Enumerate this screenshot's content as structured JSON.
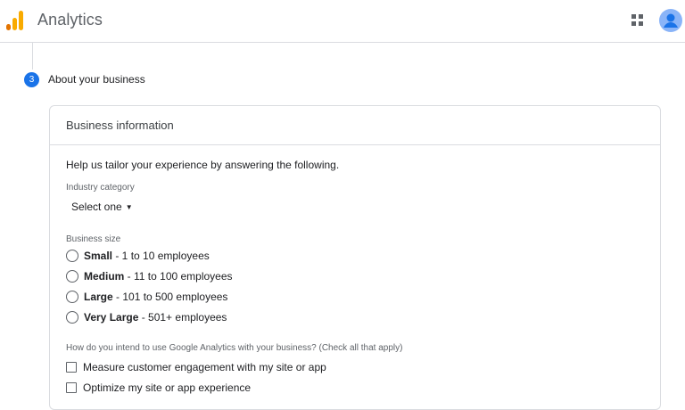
{
  "header": {
    "app_title": "Analytics"
  },
  "stepper": {
    "step_number": "3",
    "step_title": "About your business"
  },
  "card": {
    "title": "Business information",
    "intro": "Help us tailor your experience by answering the following.",
    "industry": {
      "label": "Industry category",
      "selected": "Select one"
    },
    "business_size": {
      "label": "Business size",
      "options": [
        {
          "title": "Small",
          "detail": " - 1 to 10 employees"
        },
        {
          "title": "Medium",
          "detail": " - 11 to 100 employees"
        },
        {
          "title": "Large",
          "detail": " - 101 to 500 employees"
        },
        {
          "title": "Very Large",
          "detail": " - 501+ employees"
        }
      ]
    },
    "usage": {
      "label": "How do you intend to use Google Analytics with your business? (Check all that apply)",
      "options": [
        "Measure customer engagement with my site or app",
        "Optimize my site or app experience"
      ]
    }
  },
  "colors": {
    "accent": "#1a73e8",
    "logo_dark": "#e37400",
    "logo_light": "#f9ab00",
    "avatar": "#8ab4f8"
  }
}
